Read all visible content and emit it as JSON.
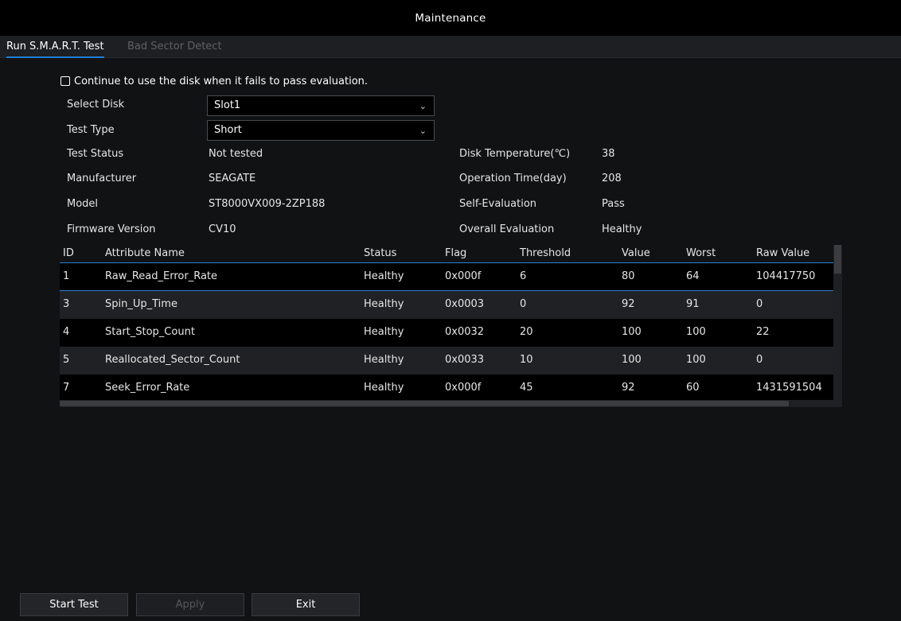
{
  "window": {
    "title": "Maintenance"
  },
  "tabs": [
    {
      "label": "Run S.M.A.R.T. Test",
      "active": true
    },
    {
      "label": "Bad Sector Detect",
      "active": false
    }
  ],
  "continue_checkbox": {
    "label": "Continue to use the disk when it fails to pass evaluation.",
    "checked": false
  },
  "form": {
    "select_disk": {
      "label": "Select Disk",
      "value": "Slot1"
    },
    "test_type": {
      "label": "Test Type",
      "value": "Short"
    },
    "test_status": {
      "label": "Test Status",
      "value": "Not tested"
    },
    "manufacturer": {
      "label": "Manufacturer",
      "value": "SEAGATE"
    },
    "model": {
      "label": "Model",
      "value": "ST8000VX009-2ZP188"
    },
    "firmware": {
      "label": "Firmware Version",
      "value": "CV10"
    },
    "disk_temp": {
      "label": "Disk Temperature(℃)",
      "value": "38"
    },
    "operation_time": {
      "label": "Operation Time(day)",
      "value": "208"
    },
    "self_eval": {
      "label": "Self-Evaluation",
      "value": "Pass"
    },
    "overall_eval": {
      "label": "Overall Evaluation",
      "value": "Healthy"
    }
  },
  "table": {
    "columns": [
      "ID",
      "Attribute Name",
      "Status",
      "Flag",
      "Threshold",
      "Value",
      "Worst",
      "Raw Value"
    ],
    "rows": [
      [
        "1",
        "Raw_Read_Error_Rate",
        "Healthy",
        "0x000f",
        "6",
        "80",
        "64",
        "104417750"
      ],
      [
        "3",
        "Spin_Up_Time",
        "Healthy",
        "0x0003",
        "0",
        "92",
        "91",
        "0"
      ],
      [
        "4",
        "Start_Stop_Count",
        "Healthy",
        "0x0032",
        "20",
        "100",
        "100",
        "22"
      ],
      [
        "5",
        "Reallocated_Sector_Count",
        "Healthy",
        "0x0033",
        "10",
        "100",
        "100",
        "0"
      ],
      [
        "7",
        "Seek_Error_Rate",
        "Healthy",
        "0x000f",
        "45",
        "92",
        "60",
        "1431591504"
      ]
    ]
  },
  "buttons": {
    "start_test": "Start Test",
    "apply": "Apply",
    "exit": "Exit"
  },
  "colors": {
    "accent": "#1f7fd6",
    "background": "#111214"
  },
  "icons": {
    "dropdown": "chevron-down-icon",
    "checkbox": "checkbox-icon"
  }
}
